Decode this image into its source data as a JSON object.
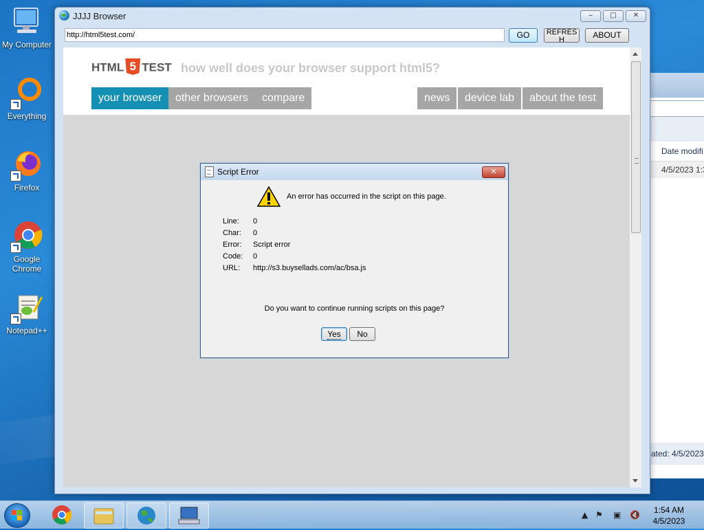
{
  "desktop": {
    "icons": [
      {
        "label": "My Computer"
      },
      {
        "label": "Everything"
      },
      {
        "label": "Firefox"
      },
      {
        "label": "Google Chrome"
      },
      {
        "label": "Notepad++"
      }
    ]
  },
  "background_window": {
    "column_header": "Date modifi",
    "row_date": "4/5/2023 1:3",
    "status_text": "ated: 4/5/2023 1"
  },
  "browser": {
    "title": "JJJJ Browser",
    "url": "http://html5test.com/",
    "go_label": "GO",
    "refresh_label": "REFRES\nH",
    "about_label": "ABOUT",
    "caption_buttons": {
      "minimize": "‒",
      "maximize": "□",
      "close": "✕"
    }
  },
  "page": {
    "logo_html": "HTML",
    "logo_five": "5",
    "logo_test": "TEST",
    "tagline": "how well does your browser support html5?",
    "nav_left": [
      "your browser",
      "other browsers",
      "compare"
    ],
    "nav_right": [
      "news",
      "device lab",
      "about the test"
    ],
    "active_nav": "your browser"
  },
  "dialog": {
    "title": "Script Error",
    "message": "An error has occurred in the script on this page.",
    "fields": [
      {
        "label": "Line:",
        "value": "0"
      },
      {
        "label": "Char:",
        "value": "0"
      },
      {
        "label": "Error:",
        "value": "Script error"
      },
      {
        "label": "Code:",
        "value": "0"
      },
      {
        "label": "URL:",
        "value": "http://s3.buysellads.com/ac/bsa.js"
      }
    ],
    "question": "Do you want to continue running scripts on this page?",
    "yes_label": "Yes",
    "no_label": "No"
  },
  "taskbar": {
    "time": "1:54 AM",
    "date": "4/5/2023"
  },
  "colors": {
    "accent_nav": "#1490b5",
    "nav_gray": "#a6a6a6",
    "html5_orange": "#e44d26"
  }
}
